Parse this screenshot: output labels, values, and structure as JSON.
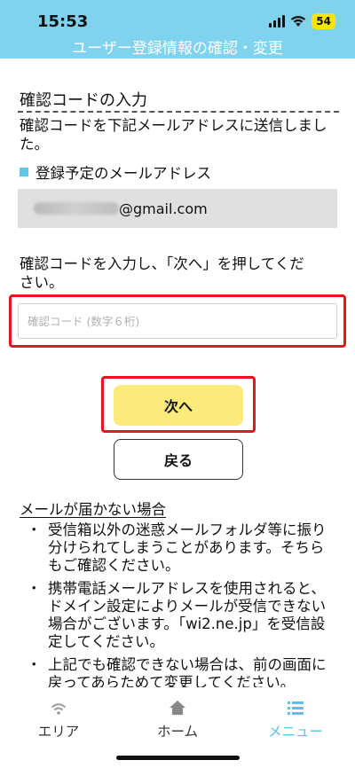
{
  "status_bar": {
    "time": "15:53",
    "battery": "54"
  },
  "header": {
    "title": "ユーザー登録情報の確認・変更"
  },
  "section": {
    "title": "確認コードの入力",
    "description": "確認コードを下記メールアドレスに送信しました。"
  },
  "email": {
    "label": "登録予定のメールアドレス",
    "domain": "@gmail.com"
  },
  "code": {
    "instruction": "確認コードを入力し、「次へ」を押してください。",
    "placeholder": "確認コード (数字６桁)",
    "value": ""
  },
  "buttons": {
    "next": "次へ",
    "back": "戻る"
  },
  "notes": {
    "title": "メールが届かない場合",
    "items": [
      "受信箱以外の迷惑メールフォルダ等に振り分けられてしまうことがあります。そちらもご確認ください。",
      "携帯電話メールアドレスを使用されると、ドメイン設定によりメールが受信できない場合がございます。「wi2.ne.jp」を受信設定してください。",
      "上記でも確認できない場合は、前の画面に戻ってあらためて変更してください。"
    ]
  },
  "tabbar": {
    "area": "エリア",
    "home": "ホーム",
    "menu": "メニュー",
    "active": "menu"
  },
  "colors": {
    "header": "#7fd3ef",
    "next_button": "#fbeb7d",
    "highlight": "#e8141b",
    "active_tab": "#55c3ea",
    "marker": "#5fc6e8"
  }
}
